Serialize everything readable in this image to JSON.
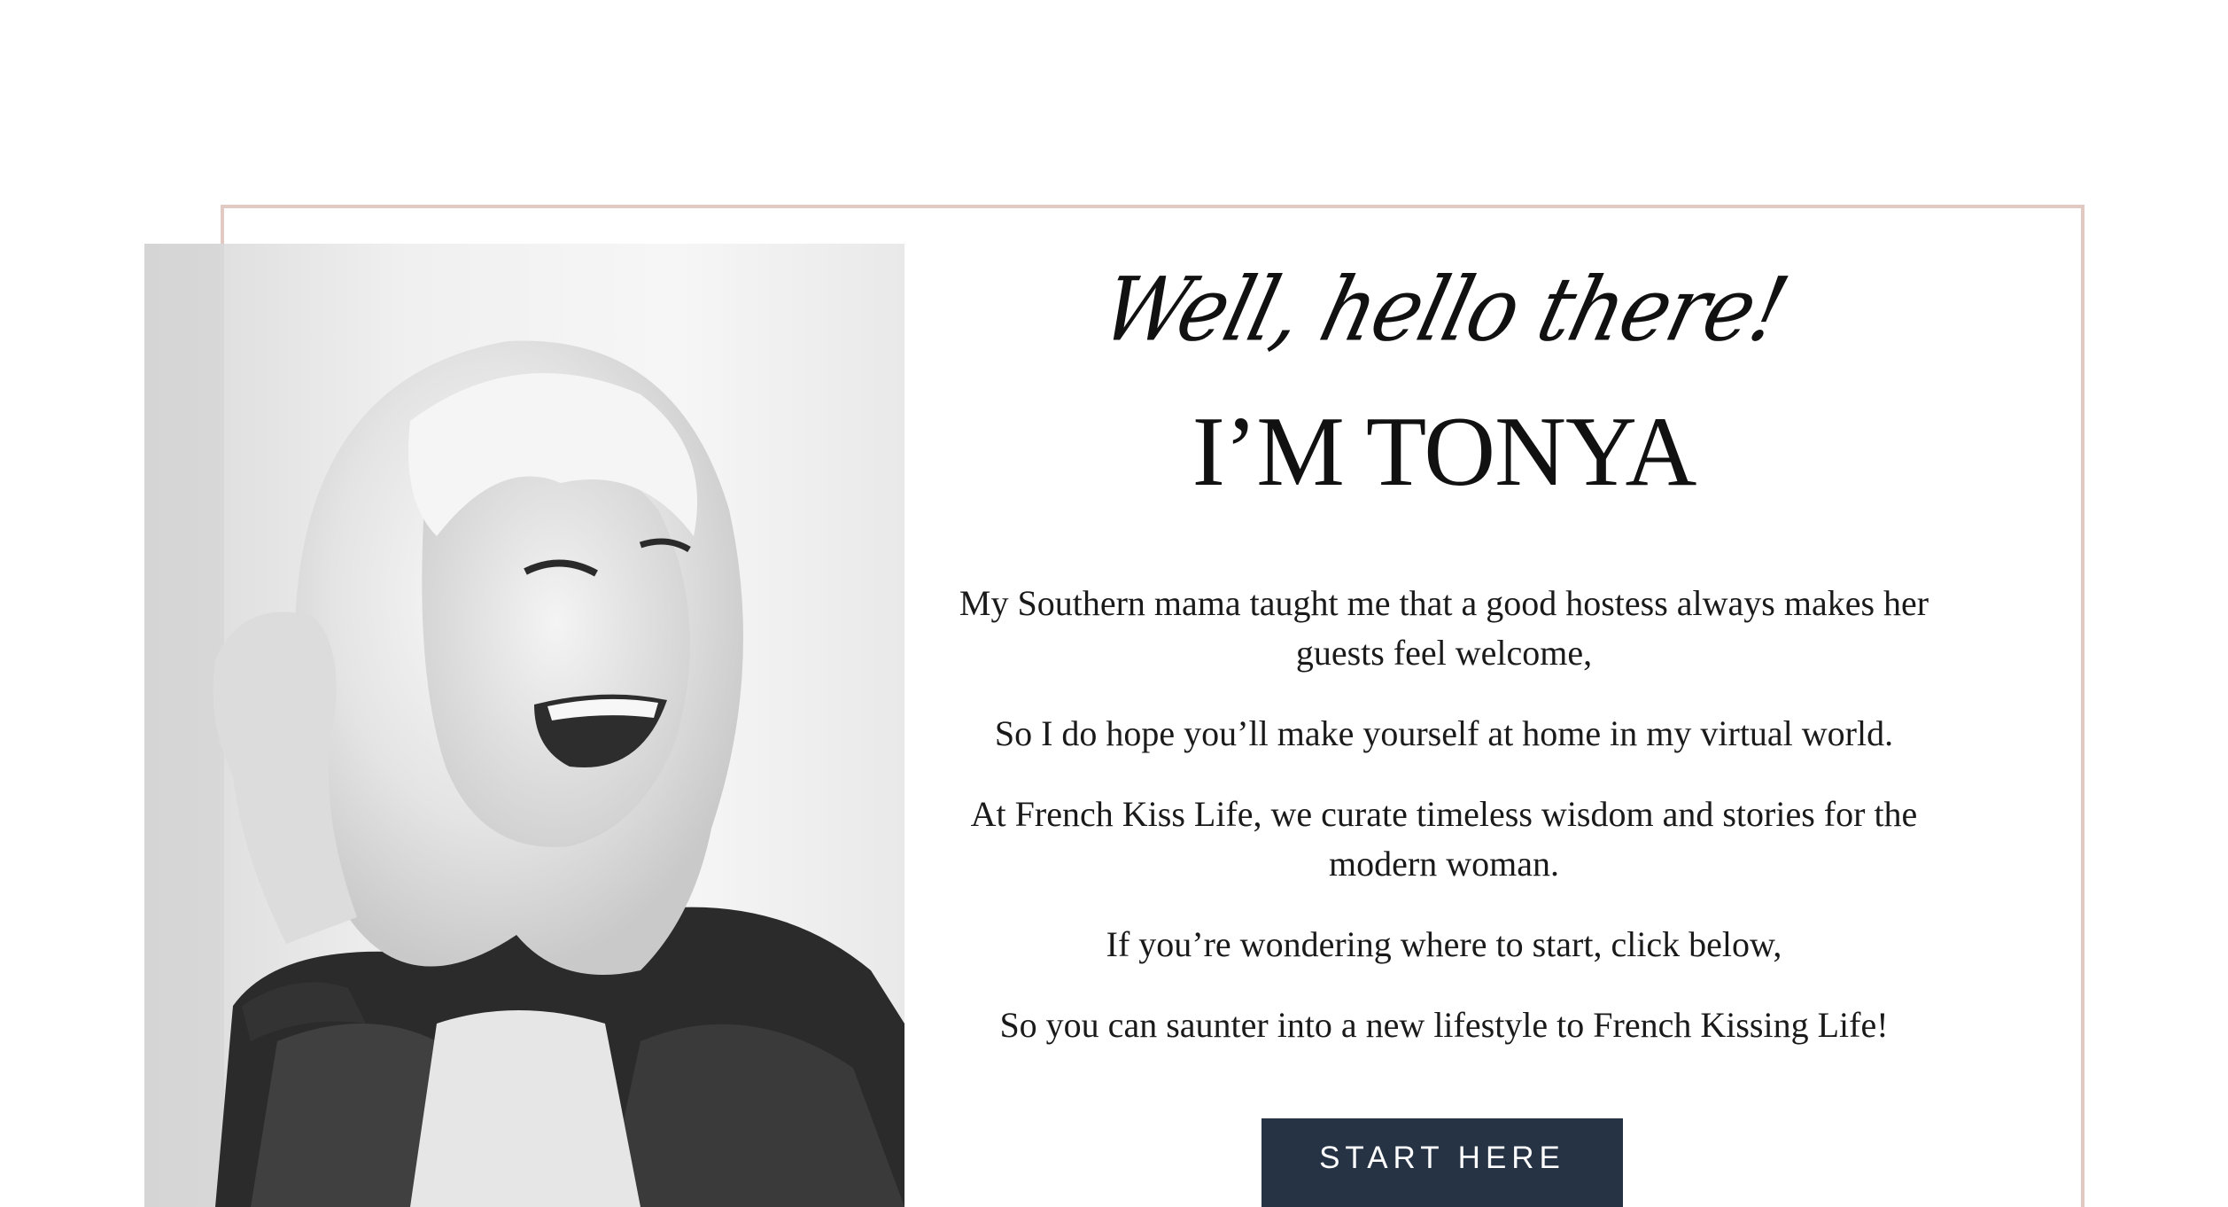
{
  "intro": {
    "greeting": "Well, hello there!",
    "headline": "I’M TONYA",
    "paragraphs": [
      "My Southern mama taught me that a good hostess always makes her guests feel welcome,",
      "So I do hope you’ll make yourself at home in my virtual world.",
      "At French Kiss Life, we curate timeless wisdom and stories for the modern woman.",
      "If you’re wondering where to start, click below,",
      "So you can saunter into a new lifestyle to French Kissing Life!"
    ],
    "cta_label": "START HERE"
  },
  "colors": {
    "frame_border": "#e2c9c2",
    "cta_background": "#253345",
    "text": "#111111"
  }
}
